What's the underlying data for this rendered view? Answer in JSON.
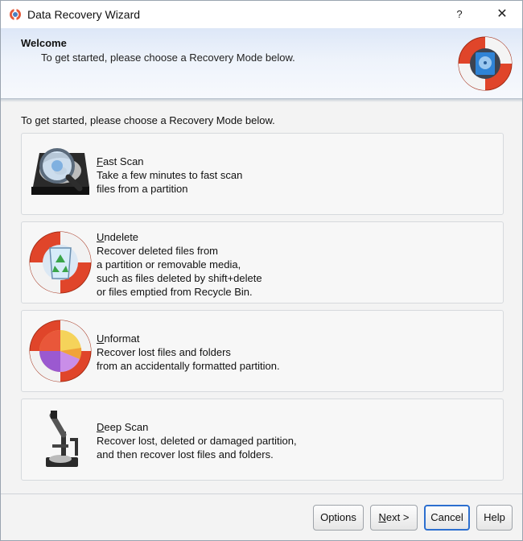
{
  "window": {
    "title": "Data Recovery Wizard",
    "help_glyph": "?",
    "close_glyph": "✕"
  },
  "banner": {
    "title": "Welcome",
    "subtitle": "To get started, please choose a Recovery Mode below."
  },
  "intro": "To get started, please choose a Recovery Mode below.",
  "modes": [
    {
      "title_first": "F",
      "title_rest": "ast Scan",
      "icon": "hard-drive-magnifier-icon",
      "lines": [
        "Take a few minutes to fast scan",
        "files from a partition"
      ]
    },
    {
      "title_first": "U",
      "title_rest": "ndelete",
      "icon": "recycle-bin-lifebuoy-icon",
      "lines": [
        "Recover deleted files from",
        "a partition or removable media,",
        "such as files deleted by shift+delete",
        "or files emptied from Recycle Bin."
      ]
    },
    {
      "title_first": "U",
      "title_rest": "nformat",
      "icon": "pie-chart-lifebuoy-icon",
      "lines": [
        "Recover lost files and folders",
        "from an accidentally formatted partition."
      ]
    },
    {
      "title_first": "D",
      "title_rest": "eep Scan",
      "icon": "microscope-icon",
      "lines": [
        "Recover lost, deleted or damaged partition,",
        "and then recover lost files and folders."
      ]
    }
  ],
  "buttons": {
    "options": "Options",
    "next_first": "N",
    "next_rest": "ext >",
    "cancel": "Cancel",
    "help": "Help"
  },
  "colors": {
    "banner_top": "#dde7f7",
    "focus_border": "#2c6fcf",
    "lifebuoy_red": "#e0452a"
  }
}
